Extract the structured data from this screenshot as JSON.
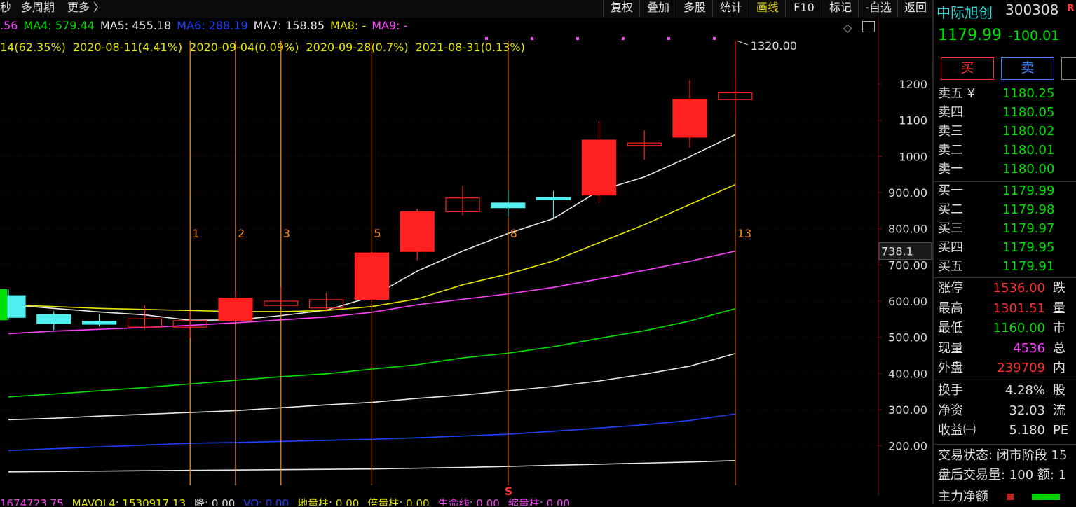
{
  "topbar": {
    "left": {
      "sec": "秒",
      "multi": "多周期",
      "more": "更多 〉"
    },
    "buttons": [
      {
        "label": "复权",
        "active": false
      },
      {
        "label": "叠加",
        "active": false
      },
      {
        "label": "多股",
        "active": false
      },
      {
        "label": "统计",
        "active": false
      },
      {
        "label": "画线",
        "active": true
      },
      {
        "label": "F10",
        "active": false
      },
      {
        "label": "标记",
        "active": false
      },
      {
        "label": "-自选",
        "active": false
      },
      {
        "label": "返回",
        "active": false
      }
    ]
  },
  "ma_legend": [
    {
      "label": ".56",
      "color": "#ff40ff"
    },
    {
      "label": "MA4: 579.44",
      "color": "#00e000"
    },
    {
      "label": "MA5: 455.18",
      "color": "#e6e6e6"
    },
    {
      "label": "MA6: 288.19",
      "color": "#2040ff"
    },
    {
      "label": "MA7: 158.85",
      "color": "#e6e6e6"
    },
    {
      "label": "MA8: -",
      "color": "#e6e600"
    },
    {
      "label": "MA9: -",
      "color": "#ff40ff"
    }
  ],
  "marks": [
    "14(62.35%)",
    "2020-08-11(4.41%)",
    "2020-09-04(0.09%)",
    "2020-09-28(0.7%)",
    "2021-08-31(0.13%)"
  ],
  "chart_data": {
    "type": "candlestick",
    "y_ticks": [
      "1200",
      "1100",
      "1000",
      "900.00",
      "800.00",
      "700.00",
      "600.00",
      "500.00",
      "400.00",
      "300.00",
      "200.00"
    ],
    "y_tick_values": [
      1200,
      1100,
      1000,
      900,
      800,
      700,
      600,
      500,
      400,
      300,
      200
    ],
    "ylim": [
      145,
      1320
    ],
    "current_price_tag": "738.1",
    "current_price_value": 738.1,
    "max_label": "1320.00",
    "max_value": 1320,
    "candles": [
      {
        "o": 555,
        "c": 615,
        "h": 632,
        "l": 548,
        "style": "cyan"
      },
      {
        "o": 538,
        "c": 563,
        "h": 572,
        "l": 520,
        "style": "cyan"
      },
      {
        "o": 536,
        "c": 544,
        "h": 565,
        "l": 530,
        "style": "cyan"
      },
      {
        "o": 528,
        "c": 551,
        "h": 588,
        "l": 522,
        "style": "hollow"
      },
      {
        "o": 528,
        "c": 546,
        "h": 571,
        "l": 499,
        "style": "hollow"
      },
      {
        "o": 547,
        "c": 608,
        "h": 624,
        "l": 547,
        "style": "solid"
      },
      {
        "o": 588,
        "c": 600,
        "h": 640,
        "l": 585,
        "style": "hollow"
      },
      {
        "o": 581,
        "c": 604,
        "h": 623,
        "l": 570,
        "style": "hollow"
      },
      {
        "o": 605,
        "c": 733,
        "h": 733,
        "l": 603,
        "style": "solid"
      },
      {
        "o": 737,
        "c": 847,
        "h": 855,
        "l": 713,
        "style": "solid"
      },
      {
        "o": 847,
        "c": 885,
        "h": 918,
        "l": 837,
        "style": "hollow"
      },
      {
        "o": 858,
        "c": 871,
        "h": 905,
        "l": 833,
        "style": "cyan"
      },
      {
        "o": 884,
        "c": 886,
        "h": 904,
        "l": 829,
        "style": "cyan"
      },
      {
        "o": 893,
        "c": 1045,
        "h": 1097,
        "l": 872,
        "style": "solid"
      },
      {
        "o": 1030,
        "c": 1037,
        "h": 1072,
        "l": 991,
        "style": "hollow"
      },
      {
        "o": 1053,
        "c": 1158,
        "h": 1212,
        "l": 1024,
        "style": "solid"
      },
      {
        "o": 1157,
        "c": 1176,
        "h": 1320,
        "l": 1109,
        "style": "hollow"
      }
    ],
    "ma_lines": [
      {
        "color": "#e6e6e6",
        "values": [
          590,
          580,
          570,
          562,
          547,
          548,
          560,
          575,
          612,
          683,
          738,
          787,
          828,
          905,
          943,
          999,
          1060
        ]
      },
      {
        "color": "#e6e600",
        "values": [
          590,
          585,
          580,
          577,
          574,
          571,
          571,
          574,
          585,
          606,
          645,
          675,
          711,
          761,
          811,
          867,
          922
        ]
      },
      {
        "color": "#ff40ff",
        "values": [
          510,
          517,
          522,
          527,
          533,
          540,
          548,
          556,
          569,
          590,
          605,
          620,
          638,
          661,
          685,
          710,
          738
        ]
      },
      {
        "color": "#00e000",
        "values": [
          335,
          343,
          352,
          361,
          371,
          381,
          391,
          399,
          412,
          424,
          443,
          456,
          474,
          497,
          518,
          545,
          579
        ]
      },
      {
        "color": "#e6e6e6",
        "values": [
          272,
          276,
          282,
          287,
          292,
          297,
          305,
          313,
          320,
          331,
          340,
          352,
          364,
          379,
          398,
          420,
          455
        ]
      },
      {
        "color": "#2040ff",
        "values": [
          187,
          192,
          197,
          202,
          207,
          209,
          212,
          215,
          218,
          222,
          227,
          232,
          240,
          249,
          258,
          270,
          288
        ]
      },
      {
        "color": "#e6e6e6",
        "values": [
          128,
          129,
          130,
          131,
          132,
          133,
          134,
          135,
          136,
          138,
          140,
          143,
          146,
          149,
          152,
          155,
          159
        ]
      }
    ],
    "vlines": [
      {
        "label": "1",
        "index": 4
      },
      {
        "label": "2",
        "index": 5
      },
      {
        "label": "3",
        "index": 6
      },
      {
        "label": "5",
        "index": 8
      },
      {
        "label": "8",
        "index": 11
      },
      {
        "label": "13",
        "index": 16
      }
    ],
    "s_marker": {
      "label": "S",
      "index": 11
    }
  },
  "stock": {
    "name": "中际旭创",
    "code": "300308",
    "badge": "R",
    "price": "1179.99",
    "change": "-100.01",
    "buy": "买",
    "sell": "卖"
  },
  "orderbook": {
    "asks": [
      {
        "label": "卖五 ¥",
        "price": "1180.25"
      },
      {
        "label": "卖四",
        "price": "1180.05"
      },
      {
        "label": "卖三",
        "price": "1180.02"
      },
      {
        "label": "卖二",
        "price": "1180.01"
      },
      {
        "label": "卖一",
        "price": "1180.00"
      }
    ],
    "bids": [
      {
        "label": "买一",
        "price": "1179.99"
      },
      {
        "label": "买二",
        "price": "1179.98"
      },
      {
        "label": "买三",
        "price": "1179.97"
      },
      {
        "label": "买四",
        "price": "1179.95"
      },
      {
        "label": "买五",
        "price": "1179.91"
      }
    ]
  },
  "stats1": [
    {
      "label": "涨停",
      "value": "1536.00",
      "color": "#ff3030",
      "extra": "跌"
    },
    {
      "label": "最高",
      "value": "1301.51",
      "color": "#ff3030",
      "extra": "量"
    },
    {
      "label": "最低",
      "value": "1160.00",
      "color": "#00e000",
      "extra": "市"
    },
    {
      "label": "现量",
      "value": "4536",
      "color": "#ff40ff",
      "extra": "总"
    },
    {
      "label": "外盘",
      "value": "239709",
      "color": "#ff3030",
      "extra": "内"
    }
  ],
  "stats2": [
    {
      "label": "换手",
      "value": "4.28%",
      "color": "#ddd",
      "extra": "股"
    },
    {
      "label": "净资",
      "value": "32.03",
      "color": "#ddd",
      "extra": "流"
    },
    {
      "label": "收益㈠",
      "value": "5.180",
      "color": "#ddd",
      "extra": "PE"
    }
  ],
  "status": {
    "trade_state": "交易状态: 闭市阶段 15",
    "after_volume": "盘后交易量: 100  额: 1",
    "main_flow": "主力净额"
  },
  "bottom_indicators": [
    {
      "label": "1674723.75",
      "color": "#ff40ff"
    },
    {
      "label": "MAVOL4: 1530917.13",
      "color": "#e6e600"
    },
    {
      "label": "降: 0.00",
      "color": "#ddd"
    },
    {
      "label": "VO: 0.00",
      "color": "#2040ff"
    },
    {
      "label": "地量柱: 0.00",
      "color": "#e6e600"
    },
    {
      "label": "倍量柱: 0.00",
      "color": "#e6e600"
    },
    {
      "label": "生命线: 0.00",
      "color": "#ff40ff"
    },
    {
      "label": "缩量柱: 0.00",
      "color": "#ff40ff"
    }
  ]
}
